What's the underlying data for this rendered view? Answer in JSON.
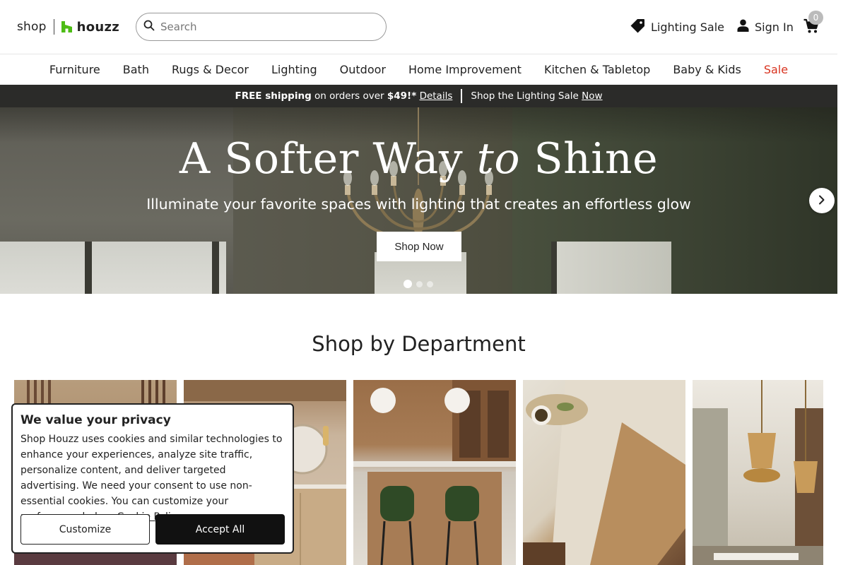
{
  "header": {
    "logo_shop": "shop",
    "logo_houzz": "houzz",
    "search_placeholder": "Search",
    "lighting_sale": "Lighting Sale",
    "sign_in": "Sign In",
    "cart_count": "0"
  },
  "nav": {
    "items": [
      "Furniture",
      "Bath",
      "Rugs & Decor",
      "Lighting",
      "Outdoor",
      "Home Improvement",
      "Kitchen & Tabletop",
      "Baby & Kids",
      "Sale"
    ]
  },
  "promo": {
    "free_shipping": "FREE shipping",
    "on_orders": " on orders over ",
    "amount": "$49!*",
    "details": "Details",
    "lighting_text": "Shop the Lighting Sale ",
    "now": "Now"
  },
  "hero": {
    "title_part1": "A Softer Way ",
    "title_italic": "to",
    "title_part2": " Shine",
    "subtitle": "Illuminate your favorite spaces with lighting that creates an effortless glow",
    "button": "Shop Now",
    "slide_count": 3,
    "active_slide": 1
  },
  "departments": {
    "title": "Shop by Department"
  },
  "cookie": {
    "title": "We value your privacy",
    "body": "Shop Houzz uses cookies and similar technologies to enhance your experiences, analyze site traffic, personalize content, and deliver targeted advertising. We need your consent to use non-essential cookies. You can customize your preferences below. ",
    "policy_link": "Cookie Policy",
    "customize": "Customize",
    "accept": "Accept All"
  },
  "colors": {
    "sale_red": "#d9331f",
    "houzz_green": "#4dbc15",
    "promo_bg": "#2b2b29"
  }
}
